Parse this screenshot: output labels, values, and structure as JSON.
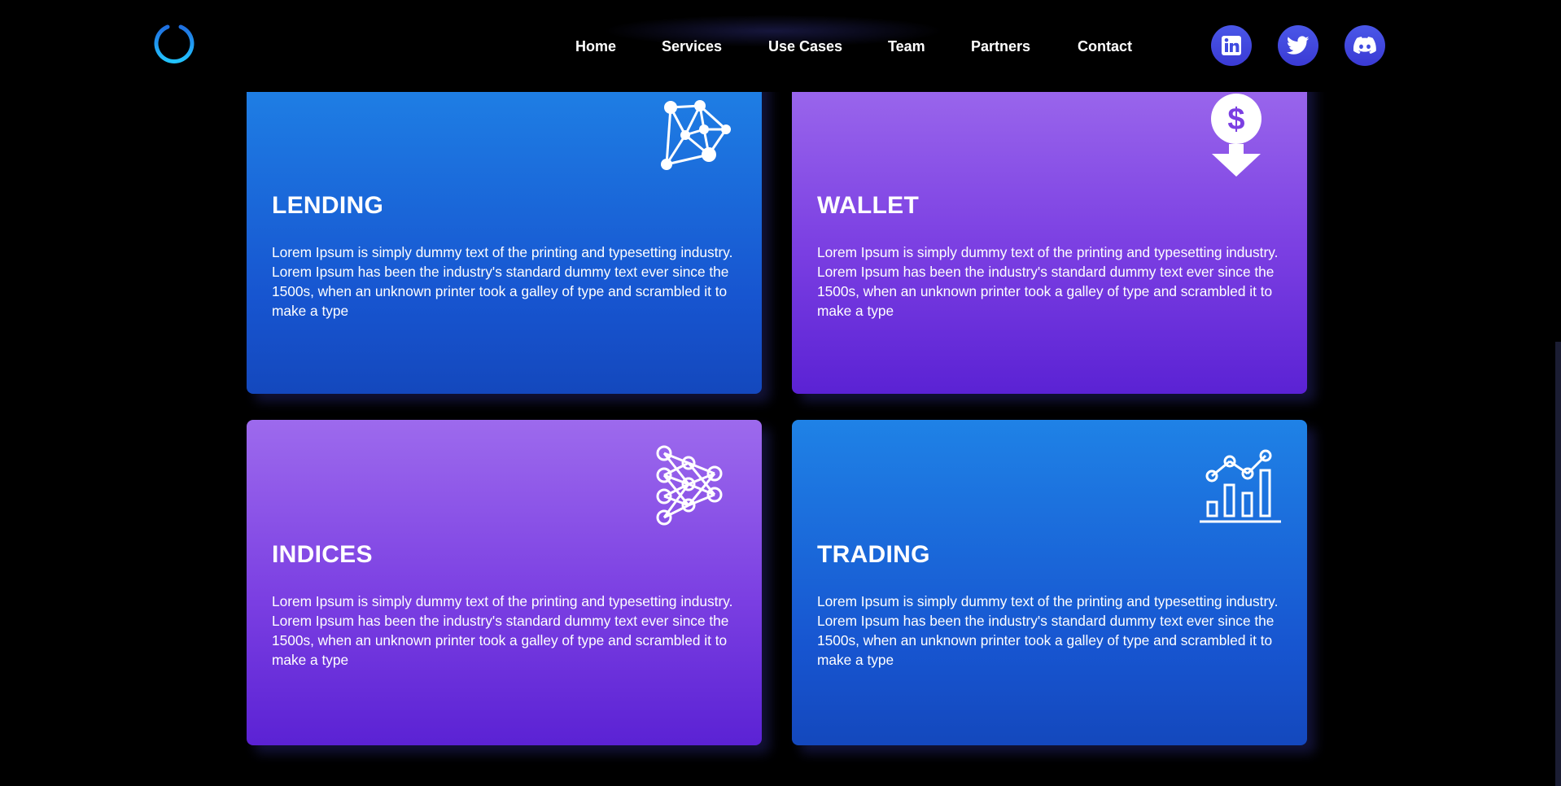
{
  "nav": {
    "items": [
      "Home",
      "Services",
      "Use Cases",
      "Team",
      "Partners",
      "Contact"
    ]
  },
  "social": {
    "icons": [
      "linkedin-icon",
      "twitter-icon",
      "discord-icon"
    ],
    "color": "#4a57e8"
  },
  "cards": [
    {
      "title": "LENDING",
      "icon": "network-graph-icon",
      "theme": "blue",
      "text": "Lorem Ipsum is simply dummy text of the printing and typesetting industry. Lorem Ipsum has been the industry's standard dummy text ever since the 1500s, when an unknown printer took a galley of type and scrambled it to make a type"
    },
    {
      "title": "WALLET",
      "icon": "dollar-down-icon",
      "theme": "purple",
      "text": "Lorem Ipsum is simply dummy text of the printing and typesetting industry. Lorem Ipsum has been the industry's standard dummy text ever since the 1500s, when an unknown printer took a galley of type and scrambled it to make a type"
    },
    {
      "title": "INDICES",
      "icon": "neural-network-icon",
      "theme": "purple",
      "text": "Lorem Ipsum is simply dummy text of the printing and typesetting industry. Lorem Ipsum has been the industry's standard dummy text ever since the 1500s, when an unknown printer took a galley of type and scrambled it to make a type"
    },
    {
      "title": "TRADING",
      "icon": "growth-chart-icon",
      "theme": "blue",
      "text": "Lorem Ipsum is simply dummy text of the printing and typesetting industry. Lorem Ipsum has been the industry's standard dummy text ever since the 1500s, when an unknown printer took a galley of type and scrambled it to make a type"
    }
  ],
  "colors": {
    "background": "#000000",
    "blue_card_top": "#1f82e6",
    "blue_card_bottom": "#1448bd",
    "purple_card_top": "#9d6aed",
    "purple_card_bottom": "#5b22d4",
    "logo_accent": "#1fa3ff"
  }
}
